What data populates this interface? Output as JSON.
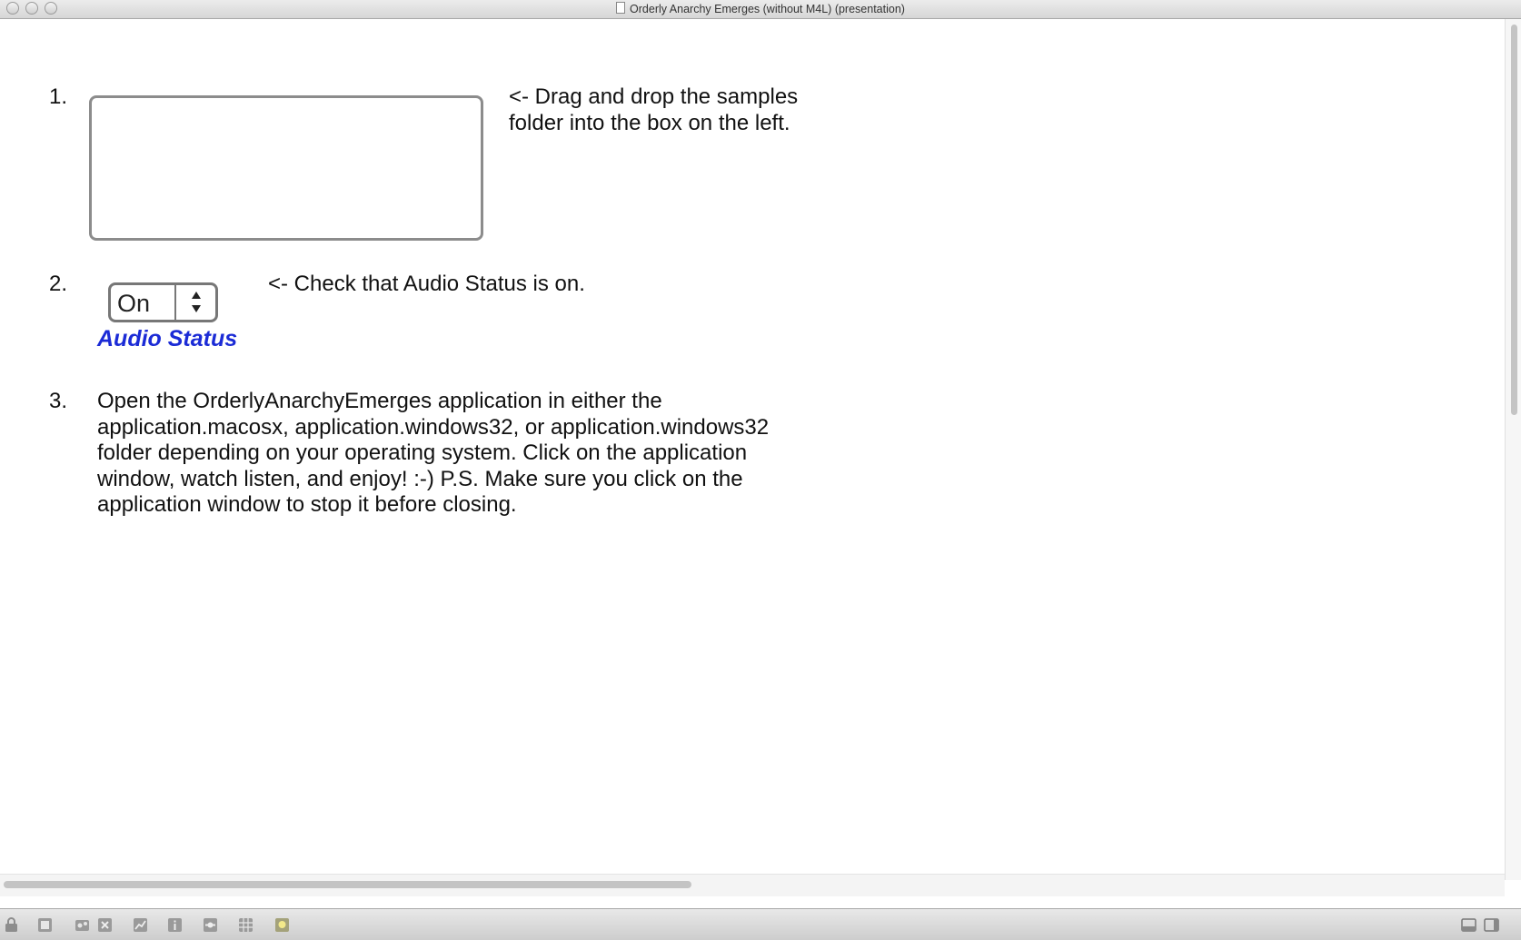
{
  "window": {
    "title": "Orderly Anarchy Emerges (without M4L) (presentation)"
  },
  "steps": [
    {
      "number": "1.",
      "text_lines": [
        "<- Drag and drop the samples",
        "folder into the box on the left."
      ]
    },
    {
      "number": "2.",
      "text": "<- Check that Audio Status is on."
    },
    {
      "number": "3.",
      "text_lines": [
        "Open the OrderlyAnarchyEmerges application in either the",
        "application.macosx, application.windows32, or application.windows32",
        "folder depending on your operating system. Click on the application",
        "window, watch listen, and enjoy! :-) P.S. Make sure you click on the",
        "application window to stop it before closing."
      ]
    }
  ],
  "audio_status": {
    "value": "On",
    "label": "Audio Status",
    "label_color": "#1b2bd6"
  },
  "toolbar": {
    "icons": [
      "lock-icon",
      "presentation-icon",
      "patcher-icon",
      "close-x-icon",
      "graph-icon",
      "info-icon",
      "inspector-icon",
      "grid-icon",
      "bulb-icon"
    ],
    "right_icons": [
      "panel-bottom-icon",
      "panel-right-icon"
    ]
  }
}
